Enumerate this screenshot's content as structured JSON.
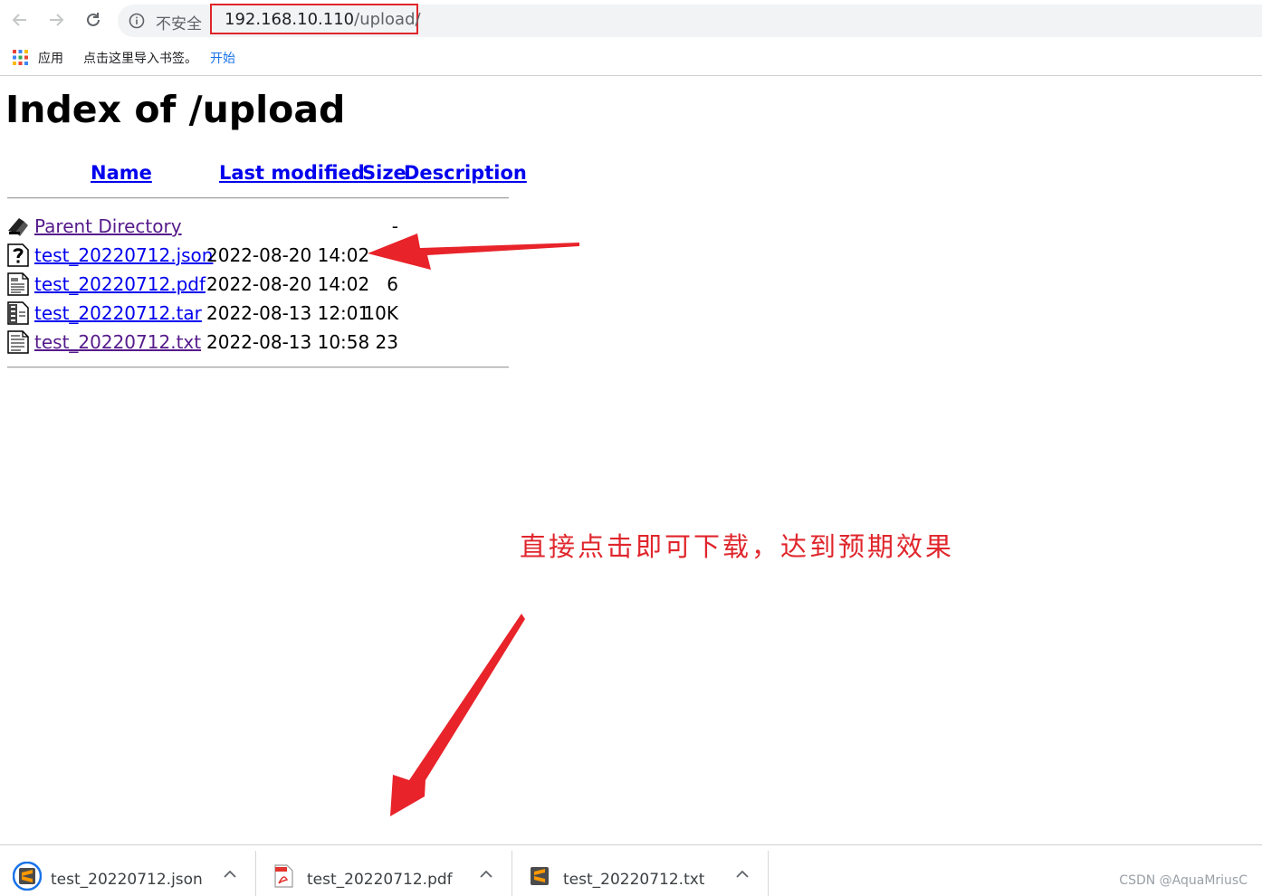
{
  "browser": {
    "security_label": "不安全",
    "url_host": "192.168.10.110",
    "url_path": "/upload/"
  },
  "bookmarks_bar": {
    "apps_label": "应用",
    "import_text": "点击这里导入书签。",
    "start_link": "开始"
  },
  "page": {
    "title": "Index of /upload",
    "columns": {
      "name": "Name",
      "last_modified": "Last modified",
      "size": "Size",
      "description": "Description"
    },
    "rows": [
      {
        "icon": "back-icon",
        "name": "Parent Directory",
        "modified": "",
        "size": "-",
        "visited": true
      },
      {
        "icon": "unknown-file-icon",
        "name": "test_20220712.json",
        "modified": "2022-08-20 14:02",
        "size": "",
        "visited": false
      },
      {
        "icon": "document-icon",
        "name": "test_20220712.pdf",
        "modified": "2022-08-20 14:02",
        "size": "6",
        "visited": false
      },
      {
        "icon": "compressed-file-icon",
        "name": "test_20220712.tar",
        "modified": "2022-08-13 12:01",
        "size": "10K",
        "visited": false
      },
      {
        "icon": "text-file-icon",
        "name": "test_20220712.txt",
        "modified": "2022-08-13 10:58",
        "size": "23",
        "visited": true
      }
    ]
  },
  "annotation": {
    "text": "直接点击即可下载，达到预期效果",
    "color": "#e0262c"
  },
  "downloads": [
    {
      "icon": "sublime-text-icon",
      "name": "test_20220712.json"
    },
    {
      "icon": "pdf-file-icon",
      "name": "test_20220712.pdf"
    },
    {
      "icon": "sublime-text-icon",
      "name": "test_20220712.txt"
    }
  ],
  "watermark": "CSDN @AquaMriusC"
}
